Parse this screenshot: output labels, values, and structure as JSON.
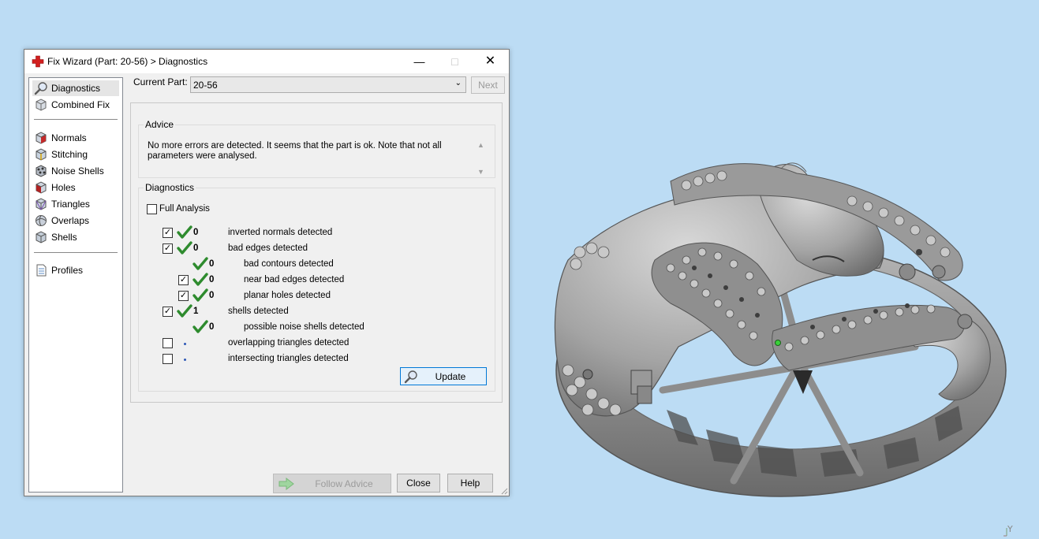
{
  "window": {
    "title": "Fix Wizard (Part: 20-56) > Diagnostics",
    "controls": [
      "minimize",
      "maximize",
      "close"
    ]
  },
  "nav": {
    "items": [
      {
        "label": "Diagnostics",
        "icon": "magnifier-icon"
      },
      {
        "label": "Combined Fix",
        "icon": "cube-icon"
      },
      {
        "label": "Normals",
        "icon": "normals-cube-icon"
      },
      {
        "label": "Stitching",
        "icon": "stitching-cube-icon"
      },
      {
        "label": "Noise Shells",
        "icon": "noise-shells-icon"
      },
      {
        "label": "Holes",
        "icon": "holes-cube-icon"
      },
      {
        "label": "Triangles",
        "icon": "triangles-cube-icon"
      },
      {
        "label": "Overlaps",
        "icon": "overlaps-sphere-icon"
      },
      {
        "label": "Shells",
        "icon": "shells-cube-icon"
      },
      {
        "label": "Profiles",
        "icon": "document-icon"
      }
    ],
    "selected": "Diagnostics"
  },
  "current_part": {
    "label": "Current Part:",
    "value": "20-56",
    "next_label": "Next"
  },
  "advice": {
    "legend": "Advice",
    "text": "No more errors are detected. It seems that the part is ok. Note that not all parameters were analysed."
  },
  "diagnostics": {
    "legend": "Diagnostics",
    "full_analysis_label": "Full Analysis",
    "full_analysis_checked": false,
    "rows": [
      {
        "checked": true,
        "status": "ok",
        "count": "0",
        "label": "inverted normals detected"
      },
      {
        "checked": true,
        "status": "ok",
        "count": "0",
        "label": "bad edges detected"
      },
      {
        "checked": null,
        "status": "ok",
        "count": "0",
        "label": "bad contours detected"
      },
      {
        "checked": true,
        "status": "ok",
        "count": "0",
        "label": "near bad edges detected"
      },
      {
        "checked": true,
        "status": "ok",
        "count": "0",
        "label": "planar holes detected"
      },
      {
        "checked": true,
        "status": "ok",
        "count": "1",
        "label": "shells detected"
      },
      {
        "checked": null,
        "status": "ok",
        "count": "0",
        "label": "possible noise shells detected"
      },
      {
        "checked": false,
        "status": "pending",
        "count": "",
        "label": "overlapping triangles detected"
      },
      {
        "checked": false,
        "status": "pending",
        "count": "",
        "label": "intersecting triangles detected"
      }
    ],
    "update_label": "Update"
  },
  "footer": {
    "follow_advice_label": "Follow Advice",
    "close_label": "Close",
    "help_label": "Help"
  },
  "viewport": {
    "axis_label": "Y",
    "background": "#bcdcf4",
    "model_color": "#a8a8a8"
  },
  "colors": {
    "title_icon": "#d21f1f",
    "check_green": "#2e8b2e",
    "pending_dot": "#2d57b6"
  }
}
